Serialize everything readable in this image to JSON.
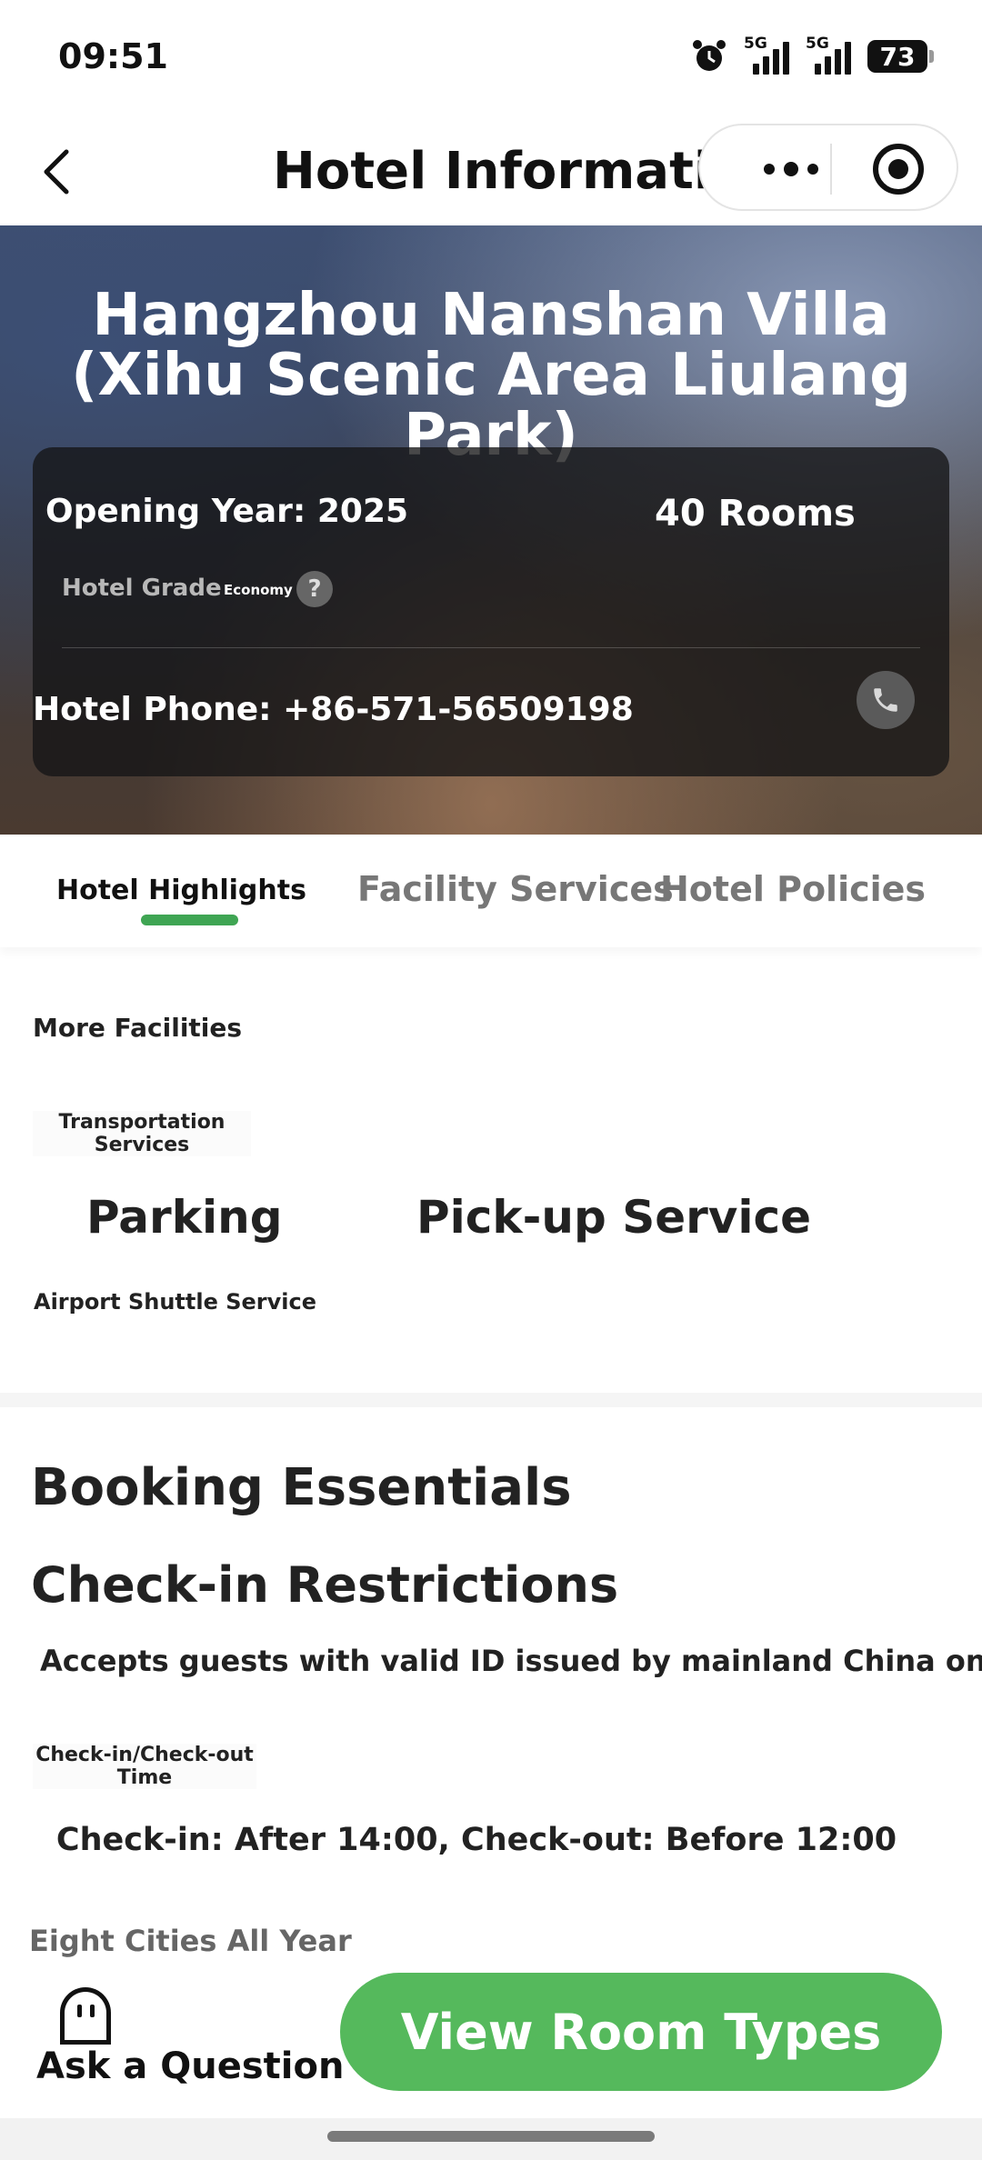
{
  "status_bar": {
    "time": "09:51",
    "network_1": "5G",
    "network_2": "5G",
    "battery": "73",
    "icons": [
      "alarm-icon",
      "signal-icon",
      "signal-icon",
      "battery-icon"
    ]
  },
  "nav": {
    "title": "Hotel Information",
    "icons": [
      "chevron-left-icon",
      "more-icon",
      "target-icon"
    ]
  },
  "hotel": {
    "name": "Hangzhou Nanshan Villa (Xihu Scenic Area Liulang Park)",
    "opening_year": "Opening Year: 2025",
    "rooms": "40 Rooms",
    "grade_label": "Hotel Grade",
    "grade_value": "Economy",
    "help": "?",
    "phone": "Hotel Phone: +86-571-56509198"
  },
  "tabs": [
    {
      "label": "Hotel Highlights",
      "active": true
    },
    {
      "label": "Facility Services",
      "active": false
    },
    {
      "label": "Hotel Policies",
      "active": false
    }
  ],
  "facilities": {
    "more_label": "More Facilities",
    "transport_label": "Transportation Services",
    "items": [
      "Parking",
      "Pick-up Service"
    ],
    "airport": "Airport Shuttle Service"
  },
  "booking": {
    "title": "Booking Essentials",
    "checkin_title": "Check-in Restrictions",
    "accepts": "Accepts guests with valid ID issued by mainland China only",
    "time_label": "Check-in/Check-out Time",
    "time_value": "Check-in: After 14:00, Check-out: Before 12:00",
    "extra": "Eight Cities All Year"
  },
  "bottom": {
    "ask_label": "Ask a Question",
    "view_button": "View Room Types"
  },
  "colors": {
    "accent_green": "#55b95c",
    "tab_indicator": "#3fa553"
  }
}
